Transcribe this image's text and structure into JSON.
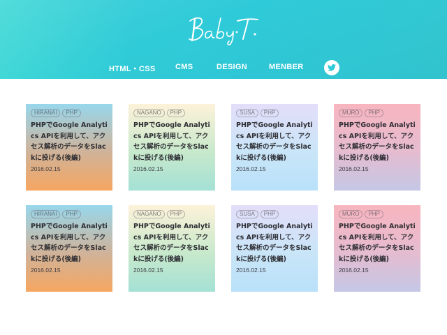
{
  "header": {
    "logo_text": "Baby T.",
    "nav": [
      {
        "label": "HTML・CSS"
      },
      {
        "label": "CMS"
      },
      {
        "label": "DESIGN"
      },
      {
        "label": "MENBER"
      }
    ],
    "twitter_icon": "twitter-icon",
    "colors": {
      "header_bg": "#30cbd8",
      "nav_text": "#ffffff"
    }
  },
  "cards": [
    {
      "author": "HIRANAI",
      "category": "PHP",
      "title": "PHPでGoogle Analytics APIを利用して、アクセス解析のデータをSlackに投げる(後編)",
      "date": "2016.02.15",
      "gradient": [
        "#97d7ec",
        "#f6a661"
      ]
    },
    {
      "author": "NAGANO",
      "category": "PHP",
      "title": "PHPでGoogle Analytics APIを利用して、アクセス解析のデータをSlackに投げる(後編)",
      "date": "2016.02.15",
      "gradient": [
        "#fdf2d9",
        "#a4e1d5"
      ]
    },
    {
      "author": "SUSA",
      "category": "PHP",
      "title": "PHPでGoogle Analytics APIを利用して、アクセス解析のデータをSlackに投げる(後編)",
      "date": "2016.02.15",
      "gradient": [
        "#e3def9",
        "#b9e1fa"
      ]
    },
    {
      "author": "MURO",
      "category": "PHP",
      "title": "PHPでGoogle Analytics APIを利用して、アクセス解析のデータをSlackに投げる(後編)",
      "date": "2016.02.15",
      "gradient": [
        "#f8b5bf",
        "#c5c7e6"
      ]
    },
    {
      "author": "HIRANAI",
      "category": "PHP",
      "title": "PHPでGoogle Analytics APIを利用して、アクセス解析のデータをSlackに投げる(後編)",
      "date": "2016.02.15",
      "gradient": [
        "#97d7ec",
        "#f6a661"
      ]
    },
    {
      "author": "NAGANO",
      "category": "PHP",
      "title": "PHPでGoogle Analytics APIを利用して、アクセス解析のデータをSlackに投げる(後編)",
      "date": "2016.02.15",
      "gradient": [
        "#fdf2d9",
        "#a4e1d5"
      ]
    },
    {
      "author": "SUSA",
      "category": "PHP",
      "title": "PHPでGoogle Analytics APIを利用して、アクセス解析のデータをSlackに投げる(後編)",
      "date": "2016.02.15",
      "gradient": [
        "#e3def9",
        "#b9e1fa"
      ]
    },
    {
      "author": "MURO",
      "category": "PHP",
      "title": "PHPでGoogle Analytics APIを利用して、アクセス解析のデータをSlackに投げる(後編)",
      "date": "2016.02.15",
      "gradient": [
        "#f8b5bf",
        "#c5c7e6"
      ]
    }
  ]
}
